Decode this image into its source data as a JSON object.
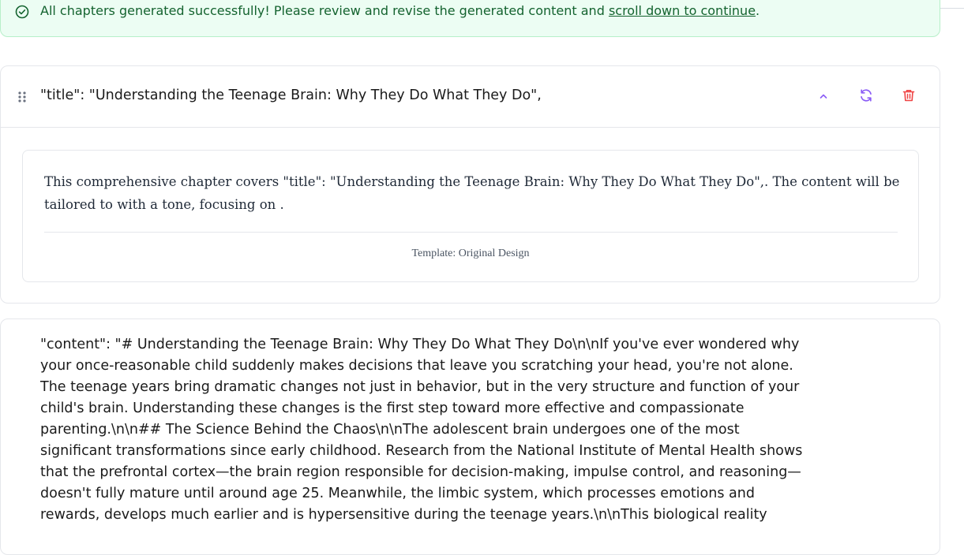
{
  "banner": {
    "message": "All chapters generated successfully! Please review and revise the generated content and ",
    "link_label": "scroll down to continue",
    "suffix": ".",
    "icon": "check-circle-icon"
  },
  "chapter": {
    "title": "\"title\": \"Understanding the Teenage Brain: Why They Do What They Do\",",
    "actions": {
      "collapse_icon": "chevron-up-icon",
      "regenerate_icon": "refresh-icon",
      "delete_icon": "trash-icon"
    },
    "preview": {
      "summary": "This comprehensive chapter covers \"title\": \"Understanding the Teenage Brain: Why They Do What They Do\",. The content will be tailored to with a tone, focusing on .",
      "template_label": "Template: Original Design"
    }
  },
  "content_block": {
    "text": "\"content\": \"# Understanding the Teenage Brain: Why They Do What They Do\\n\\nIf you've ever wondered why your once-reasonable child suddenly makes decisions that leave you scratching your head, you're not alone. The teenage years bring dramatic changes not just in behavior, but in the very structure and function of your child's brain. Understanding these changes is the first step toward more effective and compassionate parenting.\\n\\n## The Science Behind the Chaos\\n\\nThe adolescent brain undergoes one of the most significant transformations since early childhood. Research from the National Institute of Mental Health shows that the prefrontal cortex—the brain region responsible for decision-making, impulse control, and reasoning—doesn't fully mature until around age 25. Meanwhile, the limbic system, which processes emotions and rewards, develops much earlier and is hypersensitive during the teenage years.\\n\\nThis biological reality"
  },
  "colors": {
    "success_bg": "#ecfdf3",
    "success_text": "#14632f",
    "accent_purple": "#8b5cf6",
    "danger_red": "#ef4444"
  }
}
